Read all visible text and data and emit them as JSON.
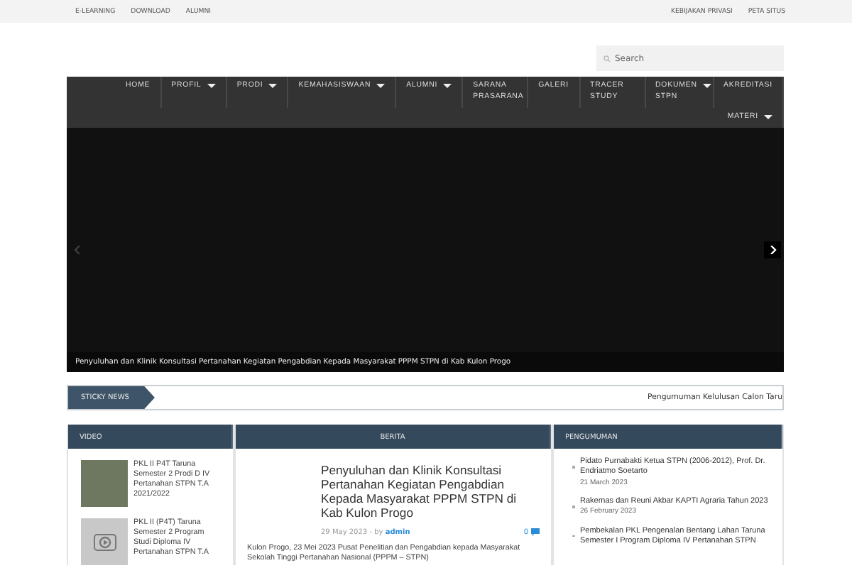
{
  "top_bar": {
    "left_links": [
      "E-LEARNING",
      "DOWNLOAD",
      "ALUMNI"
    ],
    "right_links": [
      "KEBIJAKAN PRIVASI",
      "PETA SITUS"
    ]
  },
  "search": {
    "placeholder": "Search"
  },
  "nav": [
    {
      "label": "HOME",
      "dropdown": false
    },
    {
      "label": "PROFIL",
      "dropdown": true
    },
    {
      "label": "PRODI",
      "dropdown": true
    },
    {
      "label": "KEMAHASISWAAN",
      "dropdown": true
    },
    {
      "label": "ALUMNI",
      "dropdown": true
    },
    {
      "label": "SARANA PRASARANA",
      "dropdown": false
    },
    {
      "label": "GALERI",
      "dropdown": false
    },
    {
      "label": "TRACER STUDY",
      "dropdown": false
    },
    {
      "label": "DOKUMEN STPN",
      "dropdown": true
    },
    {
      "label": "AKREDITASI",
      "dropdown": false
    },
    {
      "label": "MATERI",
      "dropdown": true
    }
  ],
  "slider": {
    "caption": "Penyuluhan dan Klinik Konsultasi Pertanahan Kegiatan Pengabdian Kepada Masyarakat PPPM STPN di Kab Kulon Progo"
  },
  "sticky_news": {
    "label": "STICKY NEWS",
    "ticker": "Pengumuman Kelulusan Calon Taru"
  },
  "video": {
    "title": "VIDEO",
    "items": [
      {
        "kind": "photo",
        "title": "PKL II P4T Taruna Semester 2 Prodi D IV Pertanahan STPN T.A 2021/2022"
      },
      {
        "kind": "blank",
        "title": "PKL II (P4T) Taruna Semester 2 Program Studi Diploma IV Pertanahan STPN T.A"
      }
    ]
  },
  "berita": {
    "title": "BERITA",
    "post": {
      "headline": "Penyuluhan dan Klinik Konsultasi Pertanahan Kegiatan Pengabdian Kepada Masyarakat PPPM STPN di Kab Kulon Progo",
      "date": "29 May 2023",
      "by": "- by",
      "author": "admin",
      "comments": "0",
      "excerpt": "Kulon Progo, 23 Mei 2023 Pusat Penelitian dan Pengabdian kepada Masyarakat Sekolah Tinggi Pertanahan Nasional (PPPM – STPN)"
    }
  },
  "pengumuman": {
    "title": "PENGUMUMAN",
    "items": [
      {
        "title": "Pidato Purnabakti Ketua STPN (2006-2012), Prof. Dr. Endriatmo Soetarto",
        "date": "21 March 2023"
      },
      {
        "title": "Rakernas dan Reuni Akbar KAPTI Agraria Tahun 2023",
        "date": "26 February 2023"
      },
      {
        "title": "Pembekalan PKL Pengenalan Bentang Lahan Taruna Semester I Program Diploma IV Pertanahan STPN"
      }
    ]
  }
}
